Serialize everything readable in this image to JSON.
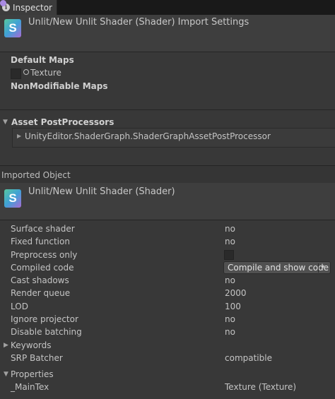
{
  "tab": {
    "label": "Inspector",
    "icon": "info-icon"
  },
  "header": {
    "title": "Unlit/New Unlit Shader (Shader) Import Settings",
    "icon_letter": "S"
  },
  "default_maps": {
    "title": "Default Maps",
    "texture_label": "Texture"
  },
  "nonmodifiable_maps": {
    "title": "NonModifiable Maps"
  },
  "asset_postprocessors": {
    "title": "Asset PostProcessors",
    "item": "UnityEditor.ShaderGraph.ShaderGraphAssetPostProcessor"
  },
  "imported_object": {
    "section_label": "Imported Object",
    "title": "Unlit/New Unlit Shader (Shader)",
    "icon_letter": "S"
  },
  "properties": {
    "surface_shader": {
      "label": "Surface shader",
      "value": "no"
    },
    "fixed_function": {
      "label": "Fixed function",
      "value": "no"
    },
    "preprocess_only": {
      "label": "Preprocess only",
      "checked": false
    },
    "compiled_code": {
      "label": "Compiled code",
      "button": "Compile and show code",
      "dropdown_arrow": "▾"
    },
    "cast_shadows": {
      "label": "Cast shadows",
      "value": "no"
    },
    "render_queue": {
      "label": "Render queue",
      "value": "2000"
    },
    "lod": {
      "label": "LOD",
      "value": "100"
    },
    "ignore_projector": {
      "label": "Ignore projector",
      "value": "no"
    },
    "disable_batching": {
      "label": "Disable batching",
      "value": "no"
    },
    "keywords": {
      "label": "Keywords"
    },
    "srp_batcher": {
      "label": "SRP Batcher",
      "value": "compatible"
    },
    "properties_section": {
      "label": "Properties"
    },
    "main_tex": {
      "label": "_MainTex",
      "value": "Texture (Texture)"
    }
  },
  "colors": {
    "background": "#383838",
    "accent": "#a98be2"
  }
}
